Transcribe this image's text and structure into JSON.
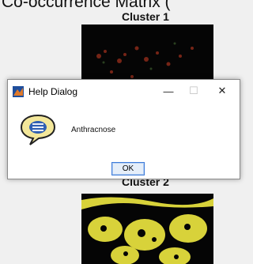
{
  "page": {
    "top_caption": "Co-occurrence Matrix ("
  },
  "figures": {
    "cluster1_title": "Cluster 1",
    "cluster2_title": "Cluster 2"
  },
  "dialog": {
    "title": "Help Dialog",
    "message": "Anthracnose",
    "ok_label": "OK",
    "minimize_glyph": "—",
    "maximize_glyph": "☐",
    "close_glyph": "✕",
    "icon": "help-speech-bubble-icon",
    "app_icon": "matlab-icon"
  },
  "colors": {
    "background": "#f0f0f0",
    "dialog_bg": "#ffffff",
    "cluster1_bg": "#050505",
    "cluster1_spots": "#8a2a1a",
    "cluster2_leaf": "#d8d23a",
    "bubble_fill": "#f3e79a",
    "button_border": "#3d7bd9"
  }
}
